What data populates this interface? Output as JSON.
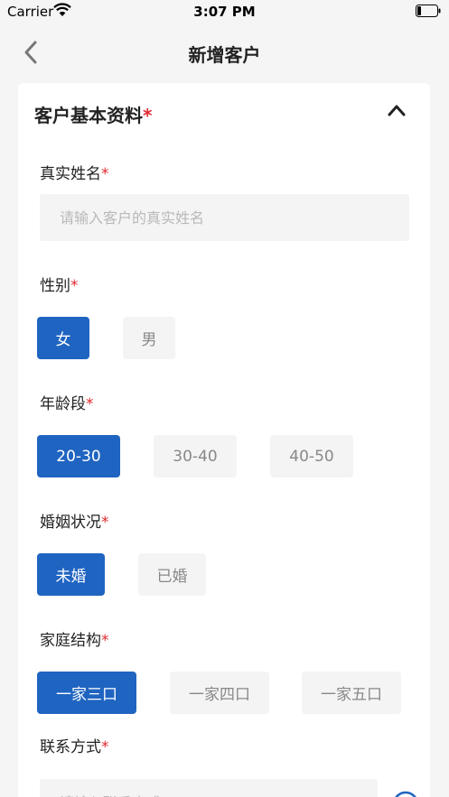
{
  "status_bar": {
    "carrier": "Carrier",
    "time": "3:07 PM"
  },
  "nav": {
    "title": "新增客户"
  },
  "section": {
    "title": "客户基本资料",
    "required_mark": "*"
  },
  "fields": {
    "name": {
      "label": "真实姓名",
      "required_mark": "*",
      "placeholder": "请输入客户的真实姓名"
    },
    "gender": {
      "label": "性别",
      "required_mark": "*",
      "options": [
        "女",
        "男"
      ],
      "selected": "女"
    },
    "age": {
      "label": "年龄段",
      "required_mark": "*",
      "options": [
        "20-30",
        "30-40",
        "40-50"
      ],
      "selected": "20-30"
    },
    "marital": {
      "label": "婚姻状况",
      "required_mark": "*",
      "options": [
        "未婚",
        "已婚"
      ],
      "selected": "未婚"
    },
    "family": {
      "label": "家庭结构",
      "required_mark": "*",
      "options": [
        "一家三口",
        "一家四口",
        "一家五口"
      ],
      "selected": "一家三口"
    },
    "contact": {
      "label": "联系方式",
      "required_mark": "*",
      "placeholder": "请输入联系方式"
    }
  },
  "colors": {
    "accent": "#1f64c1",
    "required": "#e0292f",
    "background": "#f5f5f5",
    "option_bg": "#f4f4f4"
  },
  "icons": {
    "wifi": "wifi-icon",
    "battery": "battery-icon",
    "back": "chevron-left-icon",
    "collapse": "chevron-up-icon",
    "add": "add-circle-icon"
  }
}
